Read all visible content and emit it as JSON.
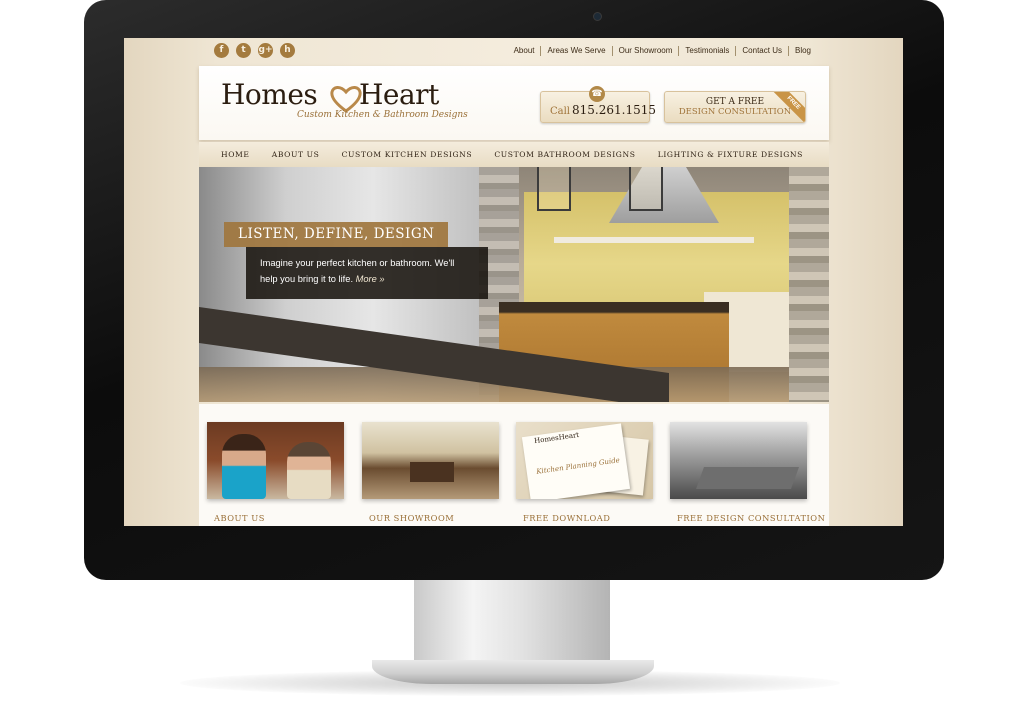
{
  "brand": {
    "name_part1": "Homes",
    "name_part2": "Heart",
    "tagline": "Custom Kitchen & Bathroom Designs"
  },
  "social_icons": [
    {
      "icon": "facebook-icon",
      "glyph": "f"
    },
    {
      "icon": "twitter-icon",
      "glyph": "t"
    },
    {
      "icon": "google-plus-icon",
      "glyph": "g+"
    },
    {
      "icon": "houzz-icon",
      "glyph": "h"
    }
  ],
  "top_nav": [
    "About",
    "Areas We Serve",
    "Our Showroom",
    "Testimonials",
    "Contact Us",
    "Blog"
  ],
  "call": {
    "label": "Call",
    "phone": "815.261.1515"
  },
  "consultation": {
    "line1": "GET A FREE",
    "line2": "DESIGN CONSULTATION",
    "tag": "FREE"
  },
  "main_nav": [
    "HOME",
    "ABOUT US",
    "CUSTOM KITCHEN DESIGNS",
    "CUSTOM BATHROOM DESIGNS",
    "LIGHTING & FIXTURE DESIGNS"
  ],
  "hero": {
    "title": "LISTEN, DEFINE, DESIGN",
    "body": "Imagine your perfect kitchen or bathroom. We'll help you bring it to life.",
    "more_link": "More »"
  },
  "cards": [
    {
      "label": "ABOUT US"
    },
    {
      "label": "OUR SHOWROOM"
    },
    {
      "label": "FREE DOWNLOAD",
      "thumb_title": "Kitchen Planning Guide",
      "thumb_brand": "HomesHeart"
    },
    {
      "label": "FREE DESIGN CONSULTATION"
    }
  ],
  "colors": {
    "accent": "#a0743a",
    "text_dark": "#2b1d10",
    "background": "#f4ecdd"
  }
}
